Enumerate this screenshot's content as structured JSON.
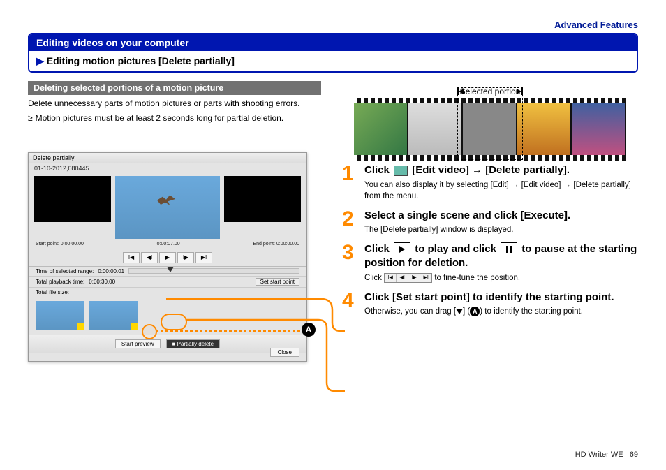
{
  "header": {
    "advanced": "Advanced Features",
    "title": "Editing videos on your computer",
    "subtitle": "Editing motion pictures [Delete partially]"
  },
  "left": {
    "section_title": "Deleting selected portions of a motion picture",
    "paragraph": "Delete unnecessary parts of motion pictures or parts with shooting errors.",
    "bullet": "Motion pictures must be at least 2 seconds long for partial deletion."
  },
  "screenshot": {
    "win_title": "Delete partially",
    "date": "01-10-2012,080445",
    "start_label": "Start point: 0:00:00.00",
    "end_label": "End point: 0:00:00.00",
    "time_label": "0:00:07.00",
    "row1_label": "Time of selected range:",
    "row1_val": "0:00:00.01",
    "row2_label": "Total playback time:",
    "row2_val": "0:00:30.00",
    "row3_label": "Total file size:",
    "setrange_btn": "Set start point",
    "btn_start": "Start preview",
    "btn_partial": "Partially delete",
    "btn_close": "Close"
  },
  "callout": {
    "A": "A"
  },
  "right": {
    "selected_label": "Selected portion"
  },
  "steps": [
    {
      "num": "1",
      "title_before": "Click ",
      "title_after": " [Edit video] → [Delete partially].",
      "desc": "You can also display it by selecting [Edit] → [Edit video] → [Delete partially] from the menu."
    },
    {
      "num": "2",
      "title": "Select a single scene and click [Execute].",
      "desc": "The [Delete partially] window is displayed."
    },
    {
      "num": "3",
      "title_before": "Click",
      "title_mid": " to play and click ",
      "title_after": " to pause at the starting position for deletion.",
      "desc_before": "Click ",
      "desc_after": " to fine-tune the position."
    },
    {
      "num": "4",
      "title": "Click [Set start point] to identify the starting point.",
      "desc_before": "Otherwise, you can drag [",
      "desc_mid": "] (",
      "desc_after": ") to identify the starting point."
    }
  ],
  "footer": {
    "product": "HD Writer WE",
    "page": "69"
  }
}
